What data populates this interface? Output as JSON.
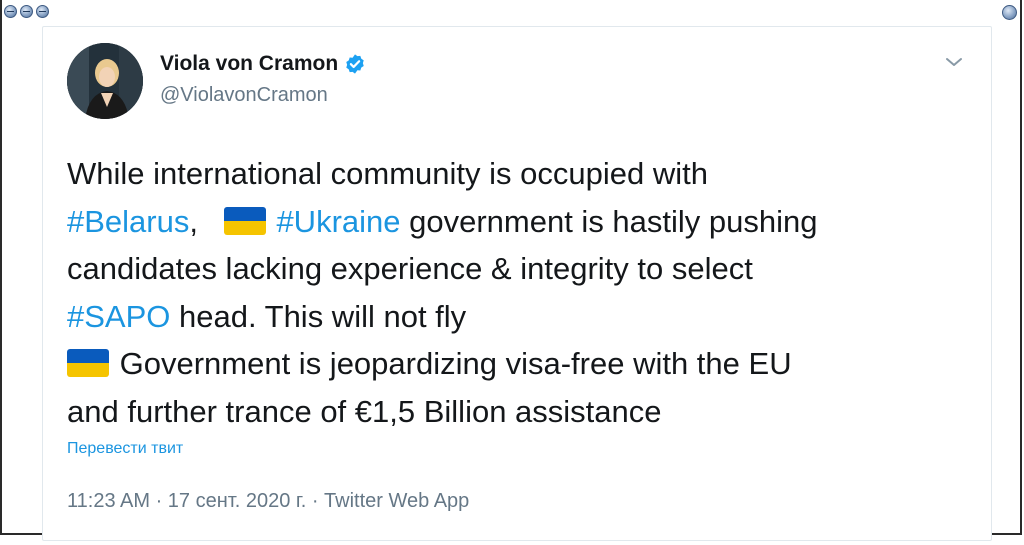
{
  "window": {
    "controls": [
      "minimize-icon",
      "minimize-icon",
      "minimize-icon"
    ],
    "right_control": "minimize-icon"
  },
  "tweet": {
    "author_name": "Viola von Cramon",
    "handle": "@ViolavonCramon",
    "verified": true,
    "lines": [
      {
        "parts": [
          {
            "type": "text",
            "text": "While international community is occupied with"
          }
        ]
      },
      {
        "parts": [
          {
            "type": "hashtag",
            "text": "#Belarus"
          },
          {
            "type": "text",
            "text": ",   "
          },
          {
            "type": "flag",
            "icon": "ukraine-flag-icon"
          },
          {
            "type": "text",
            "text": " "
          },
          {
            "type": "hashtag",
            "text": "#Ukraine"
          },
          {
            "type": "text",
            "text": " government is hastily pushing"
          }
        ]
      },
      {
        "parts": [
          {
            "type": "text",
            "text": "candidates lacking experience & integrity to select"
          }
        ]
      },
      {
        "parts": [
          {
            "type": "hashtag",
            "text": "#SAPO"
          },
          {
            "type": "text",
            "text": " head. This will not fly"
          }
        ]
      },
      {
        "parts": [
          {
            "type": "flag",
            "icon": "ukraine-flag-icon"
          },
          {
            "type": "text",
            "text": " Government is jeopardizing visa-free with the EU"
          }
        ]
      },
      {
        "parts": [
          {
            "type": "text",
            "text": "and further trance of €1,5 Billion assistance"
          }
        ]
      }
    ],
    "translate_link": "Перевести твит",
    "timestamp": "11:23 AM · 17 сент. 2020 г. · Twitter Web App"
  },
  "colors": {
    "link": "#1b95e0",
    "text": "#14171a",
    "muted": "#657786",
    "flag_blue": "#0a5bbd",
    "flag_yellow": "#f5c400"
  }
}
